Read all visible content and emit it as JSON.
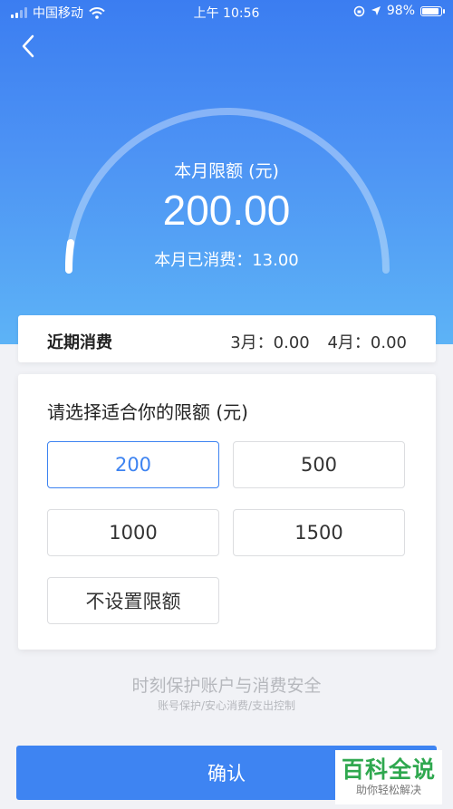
{
  "status_bar": {
    "carrier": "中国移动",
    "time": "上午 10:56",
    "battery": "98%",
    "battery_level": 0.98
  },
  "header": {
    "limit_label": "本月限额 (元)",
    "limit_value": "200.00",
    "spent_text": "本月已消费：13.00",
    "gauge_fraction": 0.065
  },
  "recent": {
    "title": "近期消费",
    "values": [
      "3月：0.00",
      "4月：0.00"
    ]
  },
  "limit_options": {
    "title": "请选择适合你的限额 (元)",
    "options": [
      "200",
      "500",
      "1000",
      "1500",
      "不设置限额"
    ],
    "selected": "200"
  },
  "footer": {
    "tagline": "时刻保护账户与消费安全",
    "subline": "账号保护/安心消费/支出控制",
    "confirm_label": "确认"
  },
  "watermark": {
    "main": "百科全说",
    "sub": "助你轻松解决"
  },
  "colors": {
    "accent": "#3e84f2",
    "header_top": "#3b7df1",
    "header_bottom": "#5db3f6",
    "watermark_green": "#2fa84f"
  },
  "icons": [
    "signal-icon",
    "wifi-icon",
    "rotation-lock-icon",
    "location-arrow-icon",
    "battery-icon",
    "back-chevron-icon"
  ]
}
